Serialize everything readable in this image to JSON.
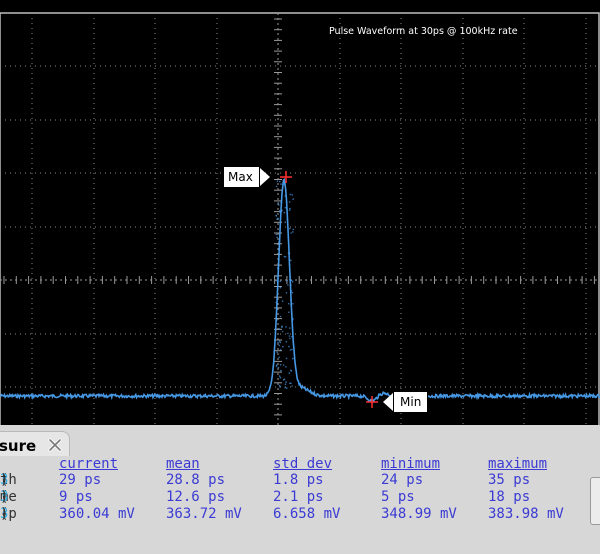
{
  "caption": "Pulse Waveform at 30ps @ 100kHz rate",
  "markers": {
    "max_label": "Max",
    "min_label": "Min"
  },
  "measure": {
    "tab_label": "sure",
    "headers": [
      "current",
      "mean",
      "std dev",
      "minimum",
      "maximum"
    ],
    "rows": [
      {
        "name": "th",
        "source": "3",
        "current": "29 ps",
        "mean": "28.8 ps",
        "std_dev": "1.8 ps",
        "minimum": "24 ps",
        "maximum": "35 ps"
      },
      {
        "name": "me",
        "source": "3",
        "current": "9 ps",
        "mean": "12.6 ps",
        "std_dev": "2.1 ps",
        "minimum": "5 ps",
        "maximum": "18 ps"
      },
      {
        "name": "-p",
        "source": "3",
        "current": "360.04 mV",
        "mean": "363.72 mV",
        "std_dev": "6.658 mV",
        "minimum": "348.99 mV",
        "maximum": "383.98 mV"
      }
    ]
  },
  "colors": {
    "trace": "#4aa0f0",
    "marker": "#ff3030",
    "measure_text": "#3b3bd4",
    "source_number": "#2fb0e8"
  }
}
